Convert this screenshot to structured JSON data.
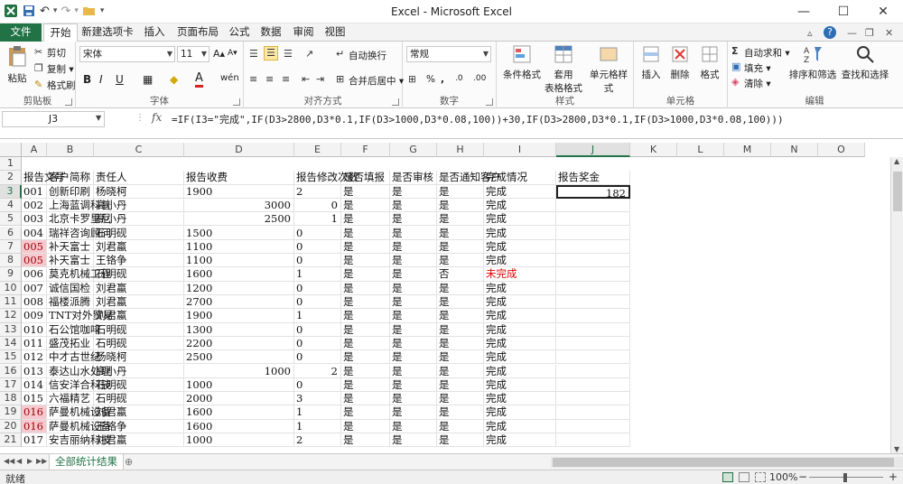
{
  "window": {
    "title": "Excel - Microsoft Excel",
    "controls": {
      "minimize": "—",
      "maximize": "☐",
      "close": "✕"
    }
  },
  "qat": {
    "undo": "↶",
    "redo": "↷",
    "dropdown": "▾"
  },
  "ribbon_tabs": [
    "文件",
    "开始",
    "新建选项卡",
    "插入",
    "页面布局",
    "公式",
    "数据",
    "审阅",
    "视图"
  ],
  "ribbon_controls": {
    "help": "?",
    "min_ribbon": "▵",
    "window_min": "—",
    "window_restore": "❐",
    "window_close": "✕"
  },
  "ribbon": {
    "clipboard": {
      "label": "剪贴板",
      "paste": "粘贴",
      "cut": "剪切",
      "copy": "复制 ▾",
      "format_painter": "格式刷"
    },
    "font": {
      "label": "字体",
      "name": "宋体",
      "size": "11",
      "grow": "A▴",
      "shrink": "A▾",
      "bold": "B",
      "italic": "I",
      "underline": "U",
      "border": "▦",
      "fill": "◆",
      "font_color": "A",
      "phonetic": "wén"
    },
    "alignment": {
      "label": "对齐方式",
      "wrap": "自动换行",
      "merge": "合并后居中 ▾"
    },
    "number": {
      "label": "数字",
      "format": "常规",
      "percent": "%",
      "comma": ",",
      "inc_dec": ".0",
      "dec_dec": ".00",
      "currency": "⊞"
    },
    "styles": {
      "label": "样式",
      "conditional": "条件格式",
      "table_line1": "套用",
      "table_line2": "表格格式",
      "cell_styles": "单元格样式"
    },
    "cells": {
      "label": "单元格",
      "insert": "插入",
      "delete": "删除",
      "format": "格式"
    },
    "editing": {
      "label": "编辑",
      "autosum": "自动求和 ▾",
      "fill": "填充 ▾",
      "clear": "清除 ▾",
      "sort": "排序和筛选",
      "find": "查找和选择"
    }
  },
  "formula_bar": {
    "name_box": "J3",
    "fx": "fx",
    "formula": "=IF(I3=\"完成\",IF(D3>2800,D3*0.1,IF(D3>1000,D3*0.08,100))+30,IF(D3>2800,D3*0.1,IF(D3>1000,D3*0.08,100)))"
  },
  "columns": [
    "A",
    "B",
    "C",
    "D",
    "E",
    "F",
    "G",
    "H",
    "I",
    "J",
    "K",
    "L",
    "M",
    "N",
    "O"
  ],
  "row_numbers": [
    "1",
    "2",
    "3",
    "4",
    "5",
    "6",
    "7",
    "8",
    "9",
    "10",
    "11",
    "12",
    "13",
    "14",
    "15",
    "16",
    "17",
    "18",
    "19",
    "20",
    "21"
  ],
  "headers": [
    "报告文号",
    "客户简称",
    "责任人",
    "报告收费",
    "报告修改次数",
    "是否填报",
    "是否审核",
    "是否通知客户",
    "完成情况",
    "报告奖金"
  ],
  "rows": [
    {
      "a": "001",
      "b": "创新印刷",
      "c": "杨晓柯",
      "d": "1900",
      "e": "2",
      "f": "是",
      "g": "是",
      "h": "是",
      "i": "完成",
      "j": "182",
      "num": false,
      "pink": false,
      "red": false
    },
    {
      "a": "002",
      "b": "上海蓝调科普",
      "c": "高小丹",
      "d": "3000",
      "e": "0",
      "f": "是",
      "g": "是",
      "h": "是",
      "i": "完成",
      "j": "",
      "num": true,
      "pink": false,
      "red": false
    },
    {
      "a": "003",
      "b": "北京卡罗里尼",
      "c": "高小丹",
      "d": "2500",
      "e": "1",
      "f": "是",
      "g": "是",
      "h": "是",
      "i": "完成",
      "j": "",
      "num": true,
      "pink": false,
      "red": false
    },
    {
      "a": "004",
      "b": "瑞祥咨询顾问",
      "c": "石明砚",
      "d": "1500",
      "e": "0",
      "f": "是",
      "g": "是",
      "h": "是",
      "i": "完成",
      "j": "",
      "num": false,
      "pink": false,
      "red": false
    },
    {
      "a": "005",
      "b": "补天富士",
      "c": "刘君蠃",
      "d": "1100",
      "e": "0",
      "f": "是",
      "g": "是",
      "h": "是",
      "i": "完成",
      "j": "",
      "num": false,
      "pink": true,
      "red": false
    },
    {
      "a": "005",
      "b": "补天富士",
      "c": "王铬争",
      "d": "1100",
      "e": "0",
      "f": "是",
      "g": "是",
      "h": "是",
      "i": "完成",
      "j": "",
      "num": false,
      "pink": true,
      "red": false
    },
    {
      "a": "006",
      "b": "莫克机械工程",
      "c": "石明砚",
      "d": "1600",
      "e": "1",
      "f": "是",
      "g": "是",
      "h": "否",
      "i": "未完成",
      "j": "",
      "num": false,
      "pink": false,
      "red": true
    },
    {
      "a": "007",
      "b": "诚信国检",
      "c": "刘君蠃",
      "d": "1200",
      "e": "0",
      "f": "是",
      "g": "是",
      "h": "是",
      "i": "完成",
      "j": "",
      "num": false,
      "pink": false,
      "red": false
    },
    {
      "a": "008",
      "b": "福楼派腾",
      "c": "刘君蠃",
      "d": "2700",
      "e": "0",
      "f": "是",
      "g": "是",
      "h": "是",
      "i": "完成",
      "j": "",
      "num": false,
      "pink": false,
      "red": false
    },
    {
      "a": "009",
      "b": "TNT对外贸易",
      "c": "刘君蠃",
      "d": "1900",
      "e": "1",
      "f": "是",
      "g": "是",
      "h": "是",
      "i": "完成",
      "j": "",
      "num": false,
      "pink": false,
      "red": false
    },
    {
      "a": "010",
      "b": "石公馆咖啡",
      "c": "石明砚",
      "d": "1300",
      "e": "0",
      "f": "是",
      "g": "是",
      "h": "是",
      "i": "完成",
      "j": "",
      "num": false,
      "pink": false,
      "red": false
    },
    {
      "a": "011",
      "b": "盛茂拓业",
      "c": "石明砚",
      "d": "2200",
      "e": "0",
      "f": "是",
      "g": "是",
      "h": "是",
      "i": "完成",
      "j": "",
      "num": false,
      "pink": false,
      "red": false
    },
    {
      "a": "012",
      "b": "中才古世纪",
      "c": "杨晓柯",
      "d": "2500",
      "e": "0",
      "f": "是",
      "g": "是",
      "h": "是",
      "i": "完成",
      "j": "",
      "num": false,
      "pink": false,
      "red": false
    },
    {
      "a": "013",
      "b": "泰达山水处理",
      "c": "高小丹",
      "d": "1000",
      "e": "2",
      "f": "是",
      "g": "是",
      "h": "是",
      "i": "完成",
      "j": "",
      "num": true,
      "pink": false,
      "red": false
    },
    {
      "a": "014",
      "b": "信安洋合科技",
      "c": "石明砚",
      "d": "1000",
      "e": "0",
      "f": "是",
      "g": "是",
      "h": "是",
      "i": "完成",
      "j": "",
      "num": false,
      "pink": false,
      "red": false
    },
    {
      "a": "015",
      "b": "六福精艺",
      "c": "石明砚",
      "d": "2000",
      "e": "3",
      "f": "是",
      "g": "是",
      "h": "是",
      "i": "完成",
      "j": "",
      "num": false,
      "pink": false,
      "red": false
    },
    {
      "a": "016",
      "b": "萨曼机械设备",
      "c": "刘君蠃",
      "d": "1600",
      "e": "1",
      "f": "是",
      "g": "是",
      "h": "是",
      "i": "完成",
      "j": "",
      "num": false,
      "pink": true,
      "red": false
    },
    {
      "a": "016",
      "b": "萨曼机械设备",
      "c": "王铬争",
      "d": "1600",
      "e": "1",
      "f": "是",
      "g": "是",
      "h": "是",
      "i": "完成",
      "j": "",
      "num": false,
      "pink": true,
      "red": false
    },
    {
      "a": "017",
      "b": "安吉丽纳科技",
      "c": "刘君蠃",
      "d": "1000",
      "e": "2",
      "f": "是",
      "g": "是",
      "h": "是",
      "i": "完成",
      "j": "",
      "num": false,
      "pink": false,
      "red": false
    }
  ],
  "sheet_tab": "全部统计结果",
  "sheet_nav": [
    "◀◀",
    "◀",
    "▶",
    "▶▶"
  ],
  "status": {
    "mode": "就绪",
    "zoom": "100%",
    "zoom_minus": "−",
    "zoom_plus": "+"
  },
  "colors": {
    "accent": "#217346",
    "duplicate_fill": "#f7c8ce",
    "incomplete_text": "#e00000"
  }
}
